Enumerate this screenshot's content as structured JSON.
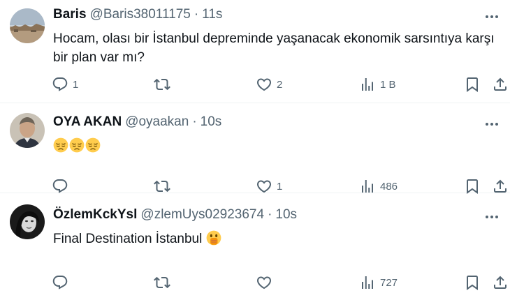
{
  "tweets": [
    {
      "name": "Baris",
      "handle": "@Baris38011175",
      "separator": "·",
      "time": "11s",
      "text": "Hocam, olası bir İstanbul depreminde yaşanacak ekonomik sarsıntıya karşı bir plan var mı?",
      "replies": "1",
      "retweets": "",
      "likes": "2",
      "views": "1 B"
    },
    {
      "name": "OYA AKAN",
      "handle": "@oyaakan",
      "separator": "·",
      "time": "10s",
      "text": "",
      "emojis": [
        "pensive-face",
        "pensive-face",
        "pensive-face"
      ],
      "replies": "",
      "retweets": "",
      "likes": "1",
      "views": "486"
    },
    {
      "name": "ÖzlemKckYsl",
      "handle": "@zlemUys02923674",
      "separator": "·",
      "time": "10s",
      "text": "Final Destination İstanbul",
      "emojis": [
        "face-with-open-eyes-and-hand-over-mouth"
      ],
      "replies": "",
      "retweets": "",
      "likes": "",
      "views": "727"
    }
  ],
  "icons": {
    "reply": "reply-icon",
    "retweet": "retweet-icon",
    "like": "heart-icon",
    "views": "views-icon",
    "bookmark": "bookmark-icon",
    "share": "share-icon",
    "more": "more-icon"
  },
  "colors": {
    "text": "#0f1419",
    "secondary": "#536471",
    "divider": "#eff3f4",
    "emoji": "#ffcc4d"
  }
}
